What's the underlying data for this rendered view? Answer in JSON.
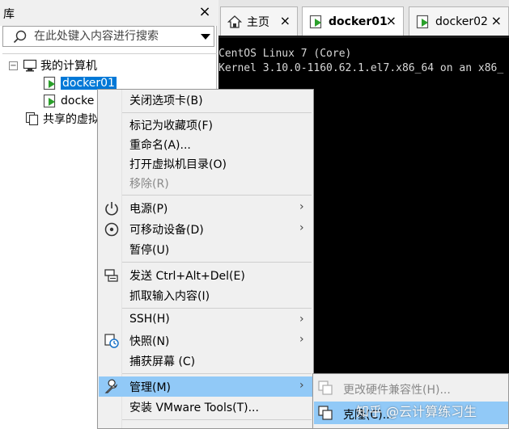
{
  "library": {
    "title": "库",
    "close": "×",
    "search": {
      "placeholder": "在此处键入内容进行搜索"
    },
    "tree": {
      "root": {
        "expander": "−",
        "label": "我的计算机"
      },
      "vms": [
        {
          "label": "docker01"
        },
        {
          "label": "docke"
        }
      ],
      "shared": {
        "label": "共享的虚拟"
      }
    }
  },
  "tabs": [
    {
      "label": "主页",
      "close": "×"
    },
    {
      "label": "docker01",
      "close": "×"
    },
    {
      "label": "docker02",
      "close": "×"
    }
  ],
  "console": {
    "lines": [
      "CentOS Linux 7 (Core)",
      "Kernel 3.10.0-1160.62.1.el7.x86_64 on an x86_"
    ]
  },
  "context_menu": {
    "items": [
      {
        "label": "关闭选项卡(B)"
      },
      {
        "label": "标记为收藏项(F)"
      },
      {
        "label": "重命名(A)..."
      },
      {
        "label": "打开虚拟机目录(O)"
      },
      {
        "label": "移除(R)"
      },
      {
        "label": "电源(P)",
        "arrow": "›"
      },
      {
        "label": "可移动设备(D)",
        "arrow": "›"
      },
      {
        "label": "暂停(U)"
      },
      {
        "label": "发送 Ctrl+Alt+Del(E)"
      },
      {
        "label": "抓取输入内容(I)"
      },
      {
        "label": "SSH(H)",
        "arrow": "›"
      },
      {
        "label": "快照(N)",
        "arrow": "›"
      },
      {
        "label": "捕获屏幕 (C)"
      },
      {
        "label": "管理(M)",
        "arrow": "›"
      },
      {
        "label": "安装 VMware Tools(T)..."
      }
    ]
  },
  "submenu": {
    "items": [
      {
        "label": "更改硬件兼容性(H)..."
      },
      {
        "label": "克隆(C)..."
      }
    ]
  },
  "watermark": "知乎 @云计算练习生",
  "colors": {
    "selection": "#0078d7",
    "menu_highlight": "#91c9f7",
    "console_bg": "#000000"
  }
}
